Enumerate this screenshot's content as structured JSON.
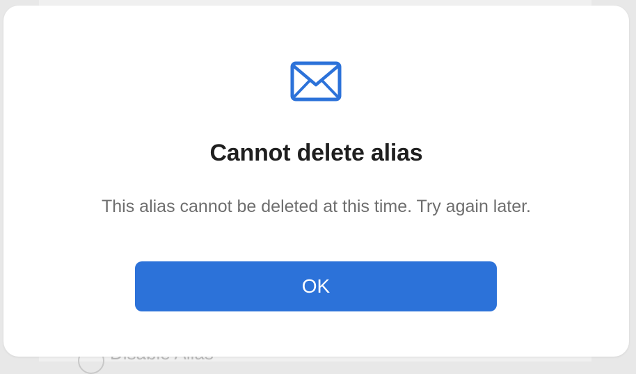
{
  "background": {
    "item_label": "Disable Alias",
    "item_icon": "circle-icon"
  },
  "dialog": {
    "icon": "envelope-icon",
    "title": "Cannot delete alias",
    "message": "This alias cannot be deleted at this time. Try again later.",
    "ok_label": "OK"
  },
  "colors": {
    "accent": "#2c72d9",
    "title": "#1f1f1f",
    "message": "#6e6e6e"
  }
}
